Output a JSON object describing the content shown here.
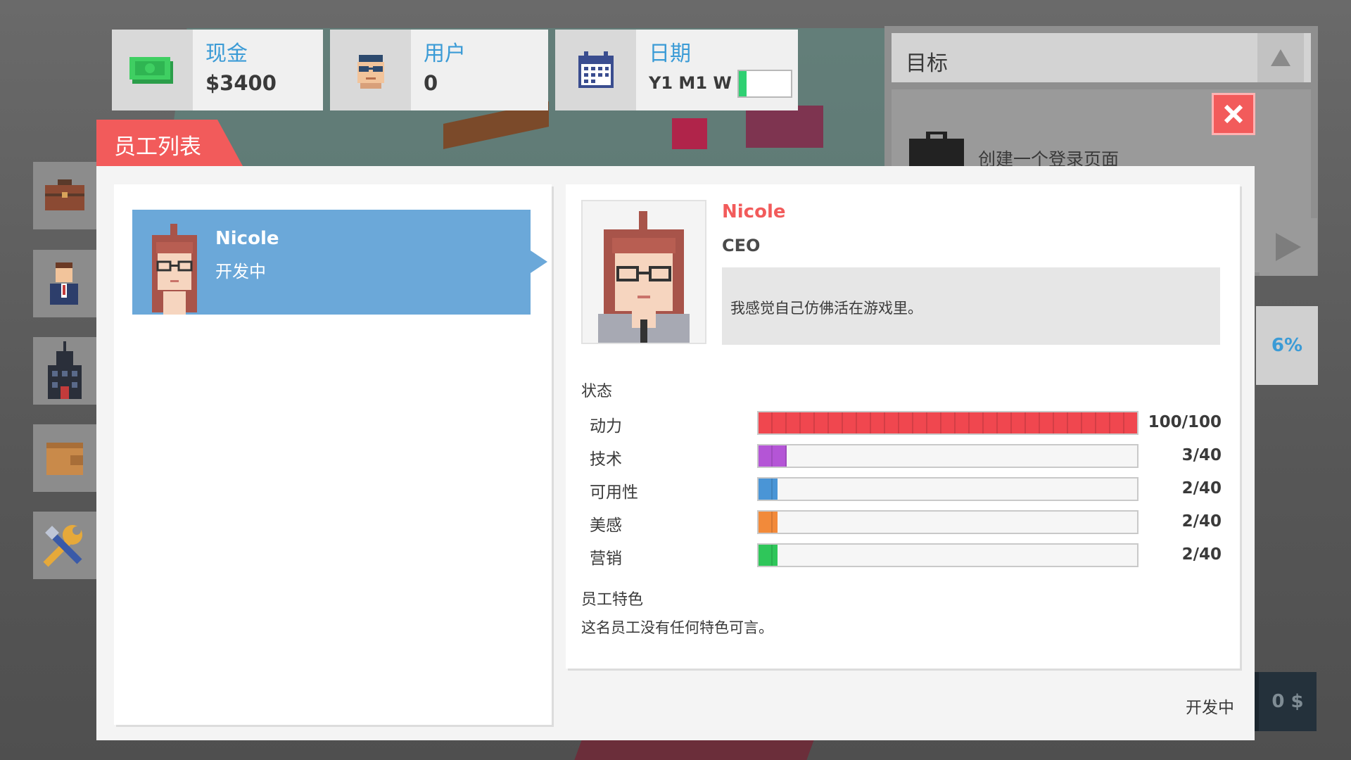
{
  "hud": {
    "cash_label": "现金",
    "cash_value": "$3400",
    "users_label": "用户",
    "users_value": "0",
    "date_label": "日期",
    "date_value": "Y1 M1 W",
    "week_progress": 0.15
  },
  "goals": {
    "title": "目标",
    "item_text": "创建一个登录页面",
    "progress_text": "6%"
  },
  "dialog": {
    "tab_title": "员工列表",
    "footer_status": "开发中",
    "cost_text": "0 $"
  },
  "employee_list": [
    {
      "name": "Nicole",
      "status": "开发中"
    }
  ],
  "detail": {
    "name": "Nicole",
    "role": "CEO",
    "quote": "我感觉自己仿佛活在游戏里。",
    "stats_title": "状态",
    "stats": [
      {
        "label": "动力",
        "value_text": "100/100",
        "value": 100,
        "max": 100,
        "color": "#f0474f"
      },
      {
        "label": "技术",
        "value_text": "3/40",
        "value": 3,
        "max": 40,
        "color": "#b455d6"
      },
      {
        "label": "可用性",
        "value_text": "2/40",
        "value": 2,
        "max": 40,
        "color": "#4a95d6"
      },
      {
        "label": "美感",
        "value_text": "2/40",
        "value": 2,
        "max": 40,
        "color": "#f28a3a"
      },
      {
        "label": "营销",
        "value_text": "2/40",
        "value": 2,
        "max": 40,
        "color": "#2fc65a"
      }
    ],
    "traits_title": "员工特色",
    "traits_text": "这名员工没有任何特色可言。"
  },
  "colors": {
    "accent": "#f25b5b",
    "info": "#3b9bd6",
    "selected": "#6ba8d9"
  },
  "icons": {
    "cash": "cash-icon",
    "users": "user-glasses-icon",
    "date": "calendar-icon",
    "pause": "pause-icon",
    "close": "close-icon",
    "up": "triangle-up-icon",
    "play": "play-icon",
    "briefcase": "briefcase-icon"
  }
}
